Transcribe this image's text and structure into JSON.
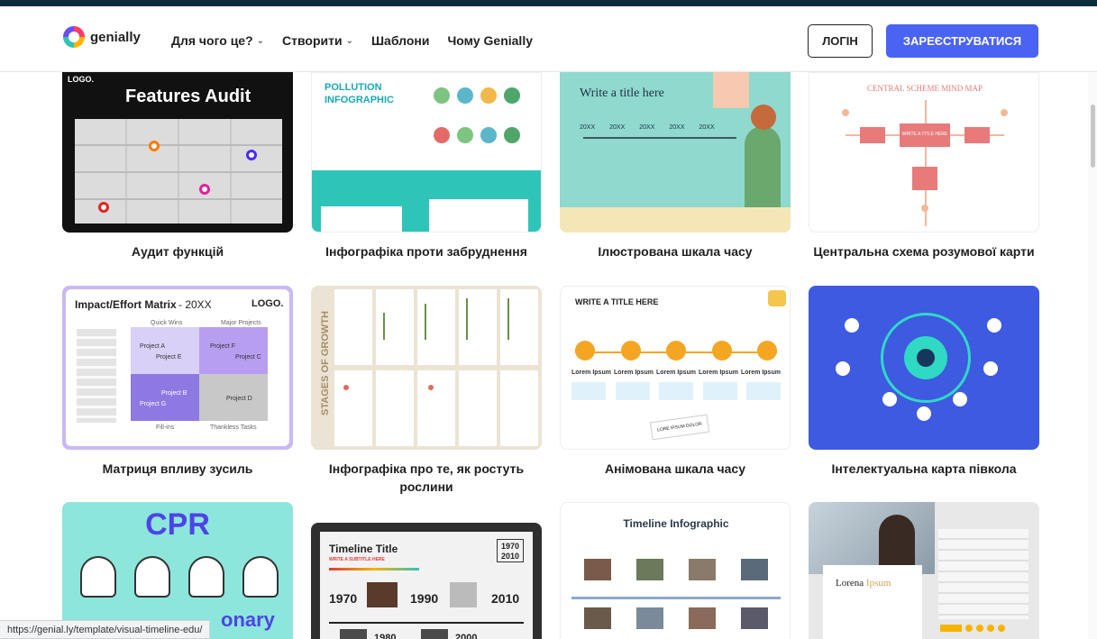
{
  "header": {
    "logo_text": "genially",
    "nav": [
      {
        "label": "Для чого це?",
        "has_dropdown": true
      },
      {
        "label": "Створити",
        "has_dropdown": true
      },
      {
        "label": "Шаблони",
        "has_dropdown": false
      },
      {
        "label": "Чому Genially",
        "has_dropdown": false
      }
    ],
    "login_label": "ЛОГІН",
    "signup_label": "ЗАРЕЄСТРУВАТИСЯ"
  },
  "colors": {
    "accent": "#4b63f3",
    "top_bar": "#0c2d3b"
  },
  "templates": [
    {
      "title": "Аудит функцій",
      "thumb_text": [
        "LOGO.",
        "Features Audit"
      ]
    },
    {
      "title": "Інфографіка проти забруднення",
      "thumb_text": [
        "POLLUTION",
        "INFOGRAPHIC"
      ]
    },
    {
      "title": "Ілюстрована шкала часу",
      "thumb_text": [
        "Write a title here",
        "20XX"
      ]
    },
    {
      "title": "Центральна схема розумової карти",
      "thumb_text": [
        "CENTRAL SCHEME MIND MAP",
        "WRITE A TITLE HERE"
      ]
    },
    {
      "title": "Матриця впливу зусиль",
      "thumb_text": [
        "Impact/Effort Matrix",
        "- 20XX",
        "LOGO.",
        "Quick Wins",
        "Major Projects",
        "Project A",
        "Project E",
        "Project F",
        "Project C",
        "Project B",
        "Project G",
        "Project D",
        "Fill-ins",
        "Thankless Tasks"
      ]
    },
    {
      "title": "Інфографіка про те, як ростуть рослини",
      "thumb_text": [
        "STAGES OF GROWTH"
      ]
    },
    {
      "title": "Анімована шкала часу",
      "thumb_text": [
        "WRITE A TITLE HERE",
        "Lorem Ipsum",
        "LORE IPSUM DOLOR"
      ]
    },
    {
      "title": "Інтелектуальна карта півкола",
      "thumb_text": []
    },
    {
      "title": "",
      "thumb_text": [
        "CPR",
        "onary"
      ]
    },
    {
      "title": "",
      "thumb_text": [
        "Timeline Title",
        "WRITE A SUBTITLE HERE",
        "1970",
        "2010",
        "1990",
        "1980",
        "2000"
      ]
    },
    {
      "title": "",
      "thumb_text": [
        "Timeline Infographic"
      ]
    },
    {
      "title": "",
      "thumb_text": [
        "Lorena",
        "Ipsum"
      ]
    }
  ],
  "status_bar": {
    "url": "https://genial.ly/template/visual-timeline-edu/"
  }
}
